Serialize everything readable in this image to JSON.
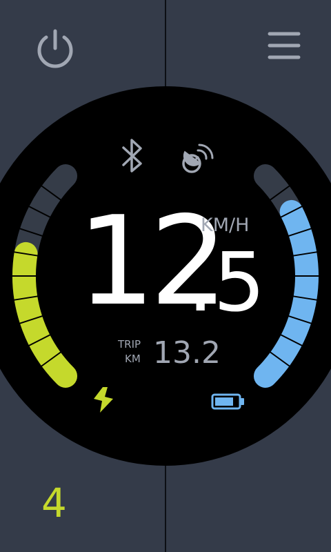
{
  "header": {
    "power_icon": "power-icon",
    "menu_icon": "hamburger-menu-icon"
  },
  "speedometer": {
    "speed_integer": "12",
    "speed_decimal": ".5",
    "speed_unit": "KM/H",
    "trip_label_line1": "TRIP",
    "trip_label_line2": "KM",
    "trip_value": "13.2",
    "status_icons": [
      "bluetooth-icon",
      "satellite-dish-icon"
    ],
    "power_gauge": {
      "icon": "lightning-bolt-icon",
      "level": 0.6,
      "color": "#c5d92c"
    },
    "battery_gauge": {
      "icon": "battery-icon",
      "level": 0.8,
      "color": "#6fb5f0"
    }
  },
  "footer": {
    "assist_level": "4"
  },
  "colors": {
    "background": "#343b49",
    "dial": "#000000",
    "gauge_empty": "#353c48",
    "accent_green": "#c5d92c",
    "accent_blue": "#6fb5f0",
    "text_muted": "#a1a7b3"
  }
}
